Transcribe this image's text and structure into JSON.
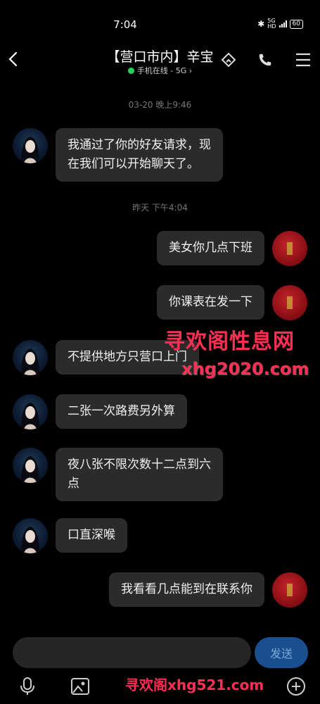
{
  "status_bar": {
    "time": "7:04",
    "bluetooth_icon": "bluetooth-icon",
    "signal_label": "5G",
    "signal_sub": "HD",
    "battery": "60"
  },
  "header": {
    "title": "【营口市内】辛宝",
    "subtitle": "手机在线 - 5G",
    "subtitle_chevron": "›",
    "back_icon": "back-arrow-icon",
    "icons": [
      "home-icon",
      "phone-icon",
      "menu-icon"
    ]
  },
  "messages": {
    "sep1": "03-20 晚上9:46",
    "m1": {
      "line1": "我通过了你的好友请求，现",
      "line2": "在我们可以开始聊天了。"
    },
    "sep2": "昨天 下午4:04",
    "m2": "美女你几点下班",
    "m3": "你课表在发一下",
    "m4": "不提供地方只营口上门",
    "m5": "二张一次路费另外算",
    "m6": {
      "line1": "夜八张不限次数十二点到六",
      "line2": "点"
    },
    "m7": "口直深喉",
    "m8": "我看看几点能到在联系你"
  },
  "watermarks": {
    "w1": "寻欢阁性息网",
    "w2": "xhg2020.com",
    "w3": "寻欢阁xhg521.com"
  },
  "input": {
    "value": "",
    "placeholder": "",
    "send_label": "发送"
  },
  "toolbar": {
    "icons": [
      "microphone-icon",
      "image-icon",
      "camera-icon",
      "emoji-icon",
      "plus-icon"
    ]
  },
  "colors": {
    "online": "#27d05a",
    "bubble": "#2b2b2b",
    "send_button": "#1a4f8f",
    "watermark": "#ff2f53"
  }
}
